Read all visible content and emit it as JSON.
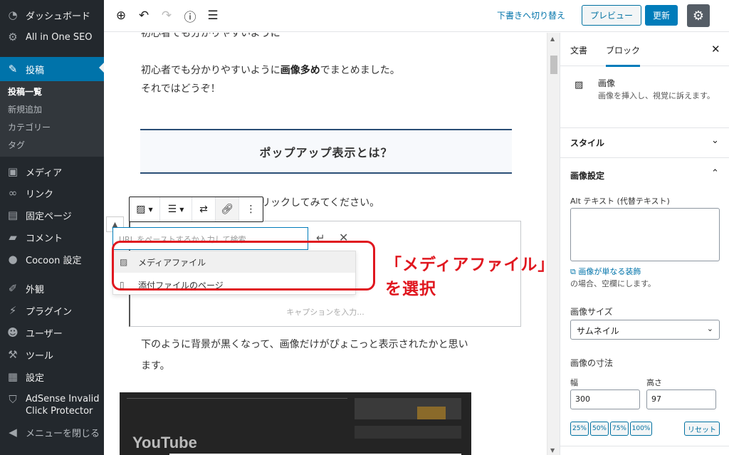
{
  "admin_menu": {
    "items": [
      {
        "label": "ダッシュボード",
        "icon": "dashboard-icon"
      },
      {
        "label": "All in One SEO",
        "icon": "gear-icon"
      },
      {
        "label": "投稿",
        "icon": "pin-icon"
      },
      {
        "label": "メディア",
        "icon": "media-icon"
      },
      {
        "label": "リンク",
        "icon": "link-icon"
      },
      {
        "label": "固定ページ",
        "icon": "page-icon"
      },
      {
        "label": "コメント",
        "icon": "comment-icon"
      },
      {
        "label": "Cocoon 設定",
        "icon": "circle-icon"
      },
      {
        "label": "外観",
        "icon": "brush-icon"
      },
      {
        "label": "プラグイン",
        "icon": "plugin-icon"
      },
      {
        "label": "ユーザー",
        "icon": "user-icon"
      },
      {
        "label": "ツール",
        "icon": "wrench-icon"
      },
      {
        "label": "設定",
        "icon": "settings-icon"
      },
      {
        "label": "AdSense Invalid",
        "label2": "Click Protector",
        "icon": "shield-icon"
      },
      {
        "label": "メニューを閉じる",
        "icon": "collapse-icon"
      }
    ],
    "submenu": [
      "投稿一覧",
      "新規追加",
      "カテゴリー",
      "タグ"
    ]
  },
  "topbar": {
    "switch_draft": "下書きへ切り替え",
    "preview": "プレビュー",
    "update": "更新"
  },
  "content": {
    "cut_line": "初心者でも分かりやすいように",
    "para1_a": "初心者でも分かりやすいように",
    "para1_b": "画像多め",
    "para1_c": "でまとめました。",
    "para2": "それではどうぞ！",
    "heading": "ポップアップ表示とは？",
    "para3_tail": "クリックしてみてください。",
    "url_placeholder": "URL をペーストするか入力して検索",
    "dropdown": [
      "メディアファイル",
      "添付ファイルのページ"
    ],
    "caption_placeholder": "キャプションを入力...",
    "annotation": "「メディアファイル」を選択",
    "para4a": "下のように背景が黒くなって、画像だけがぴょこっと表示されたかと思い",
    "para4b": "ます。",
    "embedded_youtube": "YouTube"
  },
  "settings": {
    "tab_document": "文書",
    "tab_block": "ブロック",
    "block_name": "画像",
    "block_desc": "画像を挿入し、視覚に訴えます。",
    "panel_style": "スタイル",
    "panel_image_settings": "画像設定",
    "alt_label": "Alt テキスト (代替テキスト)",
    "help_link": "画像が単なる装飾",
    "help_rest": "の場合、空欄にします。",
    "size_label": "画像サイズ",
    "size_value": "サムネイル",
    "dims_label": "画像の寸法",
    "width_label": "幅",
    "height_label": "高さ",
    "width_value": "300",
    "height_value": "97",
    "pct": [
      "25%",
      "50%",
      "75%",
      "100%"
    ],
    "reset": "リセット"
  },
  "colors": {
    "admin_bg": "#23282d",
    "admin_active": "#0073aa",
    "accent": "#007cba",
    "annotation_red": "#e0171f"
  }
}
